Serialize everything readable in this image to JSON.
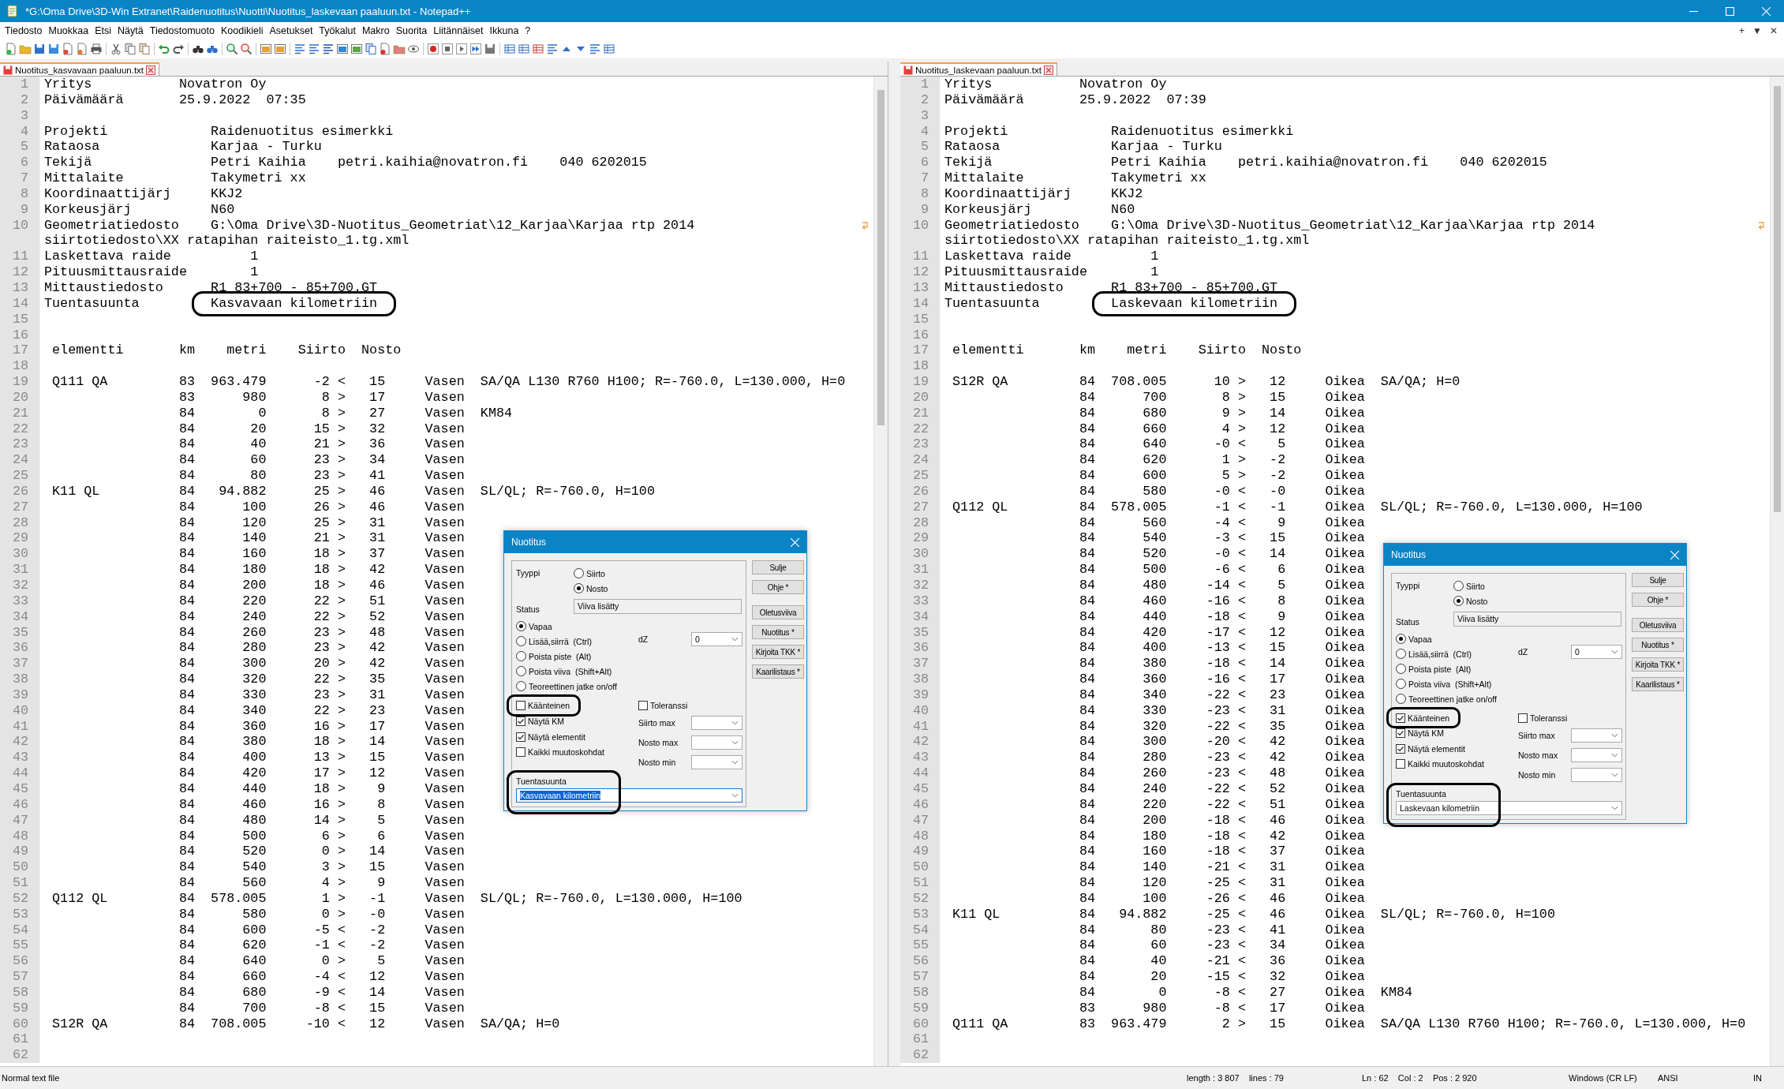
{
  "window": {
    "title": "*G:\\Oma Drive\\3D-Win Extranet\\Raidenuotitus\\Nuotti\\Nuotitus_laskevaan paaluun.txt - Notepad++"
  },
  "menu": [
    "Tiedosto",
    "Muokkaa",
    "Etsi",
    "Näytä",
    "Tiedostomuoto",
    "Koodikieli",
    "Asetukset",
    "Työkalut",
    "Makro",
    "Suorita",
    "Liitännäiset",
    "Ikkuna",
    "?"
  ],
  "menu_controls": [
    "+",
    "▼",
    "✕"
  ],
  "panes": [
    {
      "tab": {
        "label": "Nuotitus_kasvavaan paaluun.txt",
        "selected": true
      },
      "lines": [
        {
          "n": "1",
          "text": "Yritys           Novatron Oy",
          "outlined": false
        },
        {
          "n": "2",
          "text": "Päivämäärä       25.9.2022  07:35",
          "outlined": false
        },
        {
          "n": "3",
          "outlined": false
        },
        {
          "n": "4",
          "text": "Projekti             Raidenuotitus esimerkki",
          "outlined": false
        },
        {
          "n": "5",
          "text": "Rataosa              Karjaa - Turku",
          "outlined": false
        },
        {
          "n": "6",
          "text": "Tekijä               Petri Kaihia    petri.kaihia@novatron.fi    040 6202015",
          "outlined": false
        },
        {
          "n": "7",
          "text": "Mittalaite           Takymetri xx",
          "outlined": false
        },
        {
          "n": "8",
          "text": "Koordinaattijärj     KKJ2",
          "outlined": false
        },
        {
          "n": "9",
          "text": "Korkeusjärj          N60",
          "outlined": false
        },
        {
          "n": "10",
          "text": "Geometriatiedosto    G:\\Oma Drive\\3D-Nuotitus_Geometriat\\12_Karjaa\\Karjaa rtp 2014",
          "wrap": "siirtotiedosto\\XX ratapihan raiteisto_1.tg.xml",
          "outlined": false
        },
        {
          "n": "11",
          "text": "Laskettava raide          1",
          "outlined": false
        },
        {
          "n": "12",
          "text": "Pituusmittausraide        1",
          "outlined": false
        },
        {
          "n": "13",
          "text": "Mittaustiedosto      R1_83+700 - 85+700.GT",
          "outlined": false
        },
        {
          "n": "14",
          "text": "Tuentasuunta         Kasvavaan kilometriin",
          "outlined": true
        },
        {
          "n": "15",
          "outlined": false
        },
        {
          "n": "16",
          "outlined": false
        },
        {
          "n": "17",
          "text": " elementti       km    metri    Siirto  Nosto",
          "outlined": false
        },
        {
          "n": "18",
          "outlined": false
        },
        {
          "n": "19",
          "text": " Q111 QA         83  963.479      -2 <   15     Vasen  SA/QA L130 R760 H100; R=-760.0, L=130.000, H=0",
          "outlined": false
        },
        {
          "n": "20",
          "text": "                 83      980       8 >   17     Vasen",
          "outlined": false
        },
        {
          "n": "21",
          "text": "                 84        0       8 >   27     Vasen  KM84",
          "outlined": false
        },
        {
          "n": "22",
          "text": "                 84       20      15 >   32     Vasen",
          "outlined": false
        },
        {
          "n": "23",
          "text": "                 84       40      21 >   36     Vasen",
          "outlined": false
        },
        {
          "n": "24",
          "text": "                 84       60      23 >   34     Vasen",
          "outlined": false
        },
        {
          "n": "25",
          "text": "                 84       80      23 >   41     Vasen",
          "outlined": false
        },
        {
          "n": "26",
          "text": " K11 QL          84   94.882      25 >   46     Vasen  SL/QL; R=-760.0, H=100",
          "outlined": false
        },
        {
          "n": "27",
          "text": "                 84      100      26 >   46     Vasen",
          "outlined": false
        },
        {
          "n": "28",
          "text": "                 84      120      25 >   31     Vasen",
          "outlined": false
        },
        {
          "n": "29",
          "text": "                 84      140      21 >   31     Vasen",
          "outlined": false
        },
        {
          "n": "30",
          "text": "                 84      160      18 >   37     Vasen",
          "outlined": false
        },
        {
          "n": "31",
          "text": "                 84      180      18 >   42     Vasen",
          "outlined": false
        },
        {
          "n": "32",
          "text": "                 84      200      18 >   46     Vasen",
          "outlined": false
        },
        {
          "n": "33",
          "text": "                 84      220      22 >   51     Vasen",
          "outlined": false
        },
        {
          "n": "34",
          "text": "                 84      240      22 >   52     Vasen",
          "outlined": false
        },
        {
          "n": "35",
          "text": "                 84      260      23 >   48     Vasen",
          "outlined": false
        },
        {
          "n": "36",
          "text": "                 84      280      23 >   42     Vasen",
          "outlined": false
        },
        {
          "n": "37",
          "text": "                 84      300      20 >   42     Vasen",
          "outlined": false
        },
        {
          "n": "38",
          "text": "                 84      320      22 >   35     Vasen",
          "outlined": false
        },
        {
          "n": "39",
          "text": "                 84      330      23 >   31     Vasen",
          "outlined": false
        },
        {
          "n": "40",
          "text": "                 84      340      22 >   23     Vasen",
          "outlined": false
        },
        {
          "n": "41",
          "text": "                 84      360      16 >   17     Vasen",
          "outlined": false
        },
        {
          "n": "42",
          "text": "                 84      380      18 >   14     Vasen",
          "outlined": false
        },
        {
          "n": "43",
          "text": "                 84      400      13 >   15     Vasen",
          "outlined": false
        },
        {
          "n": "44",
          "text": "                 84      420      17 >   12     Vasen",
          "outlined": false
        },
        {
          "n": "45",
          "text": "                 84      440      18 >    9     Vasen",
          "outlined": false
        },
        {
          "n": "46",
          "text": "                 84      460      16 >    8     Vasen",
          "outlined": false
        },
        {
          "n": "47",
          "text": "                 84      480      14 >    5     Vasen",
          "outlined": false
        },
        {
          "n": "48",
          "text": "                 84      500       6 >    6     Vasen",
          "outlined": false
        },
        {
          "n": "49",
          "text": "                 84      520       0 >   14     Vasen",
          "outlined": false
        },
        {
          "n": "50",
          "text": "                 84      540       3 >   15     Vasen",
          "outlined": false
        },
        {
          "n": "51",
          "text": "                 84      560       4 >    9     Vasen",
          "outlined": false
        },
        {
          "n": "52",
          "text": " Q112 QL         84  578.005       1 >   -1     Vasen  SL/QL; R=-760.0, L=130.000, H=100",
          "outlined": false
        },
        {
          "n": "53",
          "text": "                 84      580       0 >   -0     Vasen",
          "outlined": false
        },
        {
          "n": "54",
          "text": "                 84      600      -5 <   -2     Vasen",
          "outlined": false
        },
        {
          "n": "55",
          "text": "                 84      620      -1 <   -2     Vasen",
          "outlined": false
        },
        {
          "n": "56",
          "text": "                 84      640       0 >    5     Vasen",
          "outlined": false
        },
        {
          "n": "57",
          "text": "                 84      660      -4 <   12     Vasen",
          "outlined": false
        },
        {
          "n": "58",
          "text": "                 84      680      -9 <   14     Vasen",
          "outlined": false
        },
        {
          "n": "59",
          "text": "                 84      700      -8 <   15     Vasen",
          "outlined": false
        },
        {
          "n": "60",
          "text": " S12R QA         84  708.005     -10 <   12     Vasen  SA/QA; H=0",
          "outlined": false
        },
        {
          "n": "61",
          "outlined": false
        },
        {
          "n": "62",
          "outlined": false
        }
      ],
      "dialog": {
        "title": "Nuotitus",
        "type_label": "Tyyppi",
        "type_options": [
          {
            "label": "Siirto",
            "selected": false
          },
          {
            "label": "Nosto",
            "selected": true
          }
        ],
        "status_label": "Status",
        "status_value": "Viiva lisätty",
        "modes": [
          {
            "label": "Vapaa",
            "selected": true
          },
          {
            "label": "Lisää,siirrä  (Ctrl)",
            "selected": false
          },
          {
            "label": "Poista piste  (Alt)",
            "selected": false
          },
          {
            "label": "Poista viiva  (Shift+Alt)",
            "selected": false
          },
          {
            "label": "Teoreettinen jatke on/off",
            "selected": false
          }
        ],
        "dz_label": "dZ",
        "dz_value": "0",
        "checkboxes": [
          {
            "label": "Käänteinen",
            "checked": false,
            "outlined": true
          },
          {
            "label": "Näytä KM",
            "checked": true,
            "outlined": false
          },
          {
            "label": "Näytä elementit",
            "checked": true,
            "outlined": false
          },
          {
            "label": "Kaikki muutoskohdat",
            "checked": false,
            "outlined": false
          }
        ],
        "tolerance": {
          "label": "Toleranssi",
          "checked": false
        },
        "limits": [
          {
            "label": "Siirto max"
          },
          {
            "label": "Nosto max"
          },
          {
            "label": "Nosto min"
          }
        ],
        "direction": {
          "label": "Tuentasuunta",
          "value": "Kasvavaan kilometriin",
          "text_selected": true,
          "outlined": true
        },
        "buttons": [
          "Sulje",
          "Ohje *",
          "Oletusviiva",
          "Nuotitus *",
          "Kirjoita TKK *",
          "Kaarilistaus *"
        ]
      }
    },
    {
      "tab": {
        "label": "Nuotitus_laskevaan paaluun.txt",
        "selected": true
      },
      "lines": [
        {
          "n": "1",
          "text": "Yritys           Novatron Oy",
          "outlined": false
        },
        {
          "n": "2",
          "text": "Päivämäärä       25.9.2022  07:39",
          "outlined": false
        },
        {
          "n": "3",
          "outlined": false
        },
        {
          "n": "4",
          "text": "Projekti             Raidenuotitus esimerkki",
          "outlined": false
        },
        {
          "n": "5",
          "text": "Rataosa              Karjaa - Turku",
          "outlined": false
        },
        {
          "n": "6",
          "text": "Tekijä               Petri Kaihia    petri.kaihia@novatron.fi    040 6202015",
          "outlined": false
        },
        {
          "n": "7",
          "text": "Mittalaite           Takymetri xx",
          "outlined": false
        },
        {
          "n": "8",
          "text": "Koordinaattijärj     KKJ2",
          "outlined": false
        },
        {
          "n": "9",
          "text": "Korkeusjärj          N60",
          "outlined": false
        },
        {
          "n": "10",
          "text": "Geometriatiedosto    G:\\Oma Drive\\3D-Nuotitus_Geometriat\\12_Karjaa\\Karjaa rtp 2014",
          "wrap": "siirtotiedosto\\XX ratapihan raiteisto_1.tg.xml",
          "outlined": false
        },
        {
          "n": "11",
          "text": "Laskettava raide          1",
          "outlined": false
        },
        {
          "n": "12",
          "text": "Pituusmittausraide        1",
          "outlined": false
        },
        {
          "n": "13",
          "text": "Mittaustiedosto      R1_83+700 - 85+700.GT",
          "outlined": false
        },
        {
          "n": "14",
          "text": "Tuentasuunta         Laskevaan kilometriin",
          "outlined": true
        },
        {
          "n": "15",
          "outlined": false
        },
        {
          "n": "16",
          "outlined": false
        },
        {
          "n": "17",
          "text": " elementti       km    metri    Siirto  Nosto",
          "outlined": false
        },
        {
          "n": "18",
          "outlined": false
        },
        {
          "n": "19",
          "text": " S12R QA         84  708.005      10 >   12     Oikea  SA/QA; H=0",
          "outlined": false
        },
        {
          "n": "20",
          "text": "                 84      700       8 >   15     Oikea",
          "outlined": false
        },
        {
          "n": "21",
          "text": "                 84      680       9 >   14     Oikea",
          "outlined": false
        },
        {
          "n": "22",
          "text": "                 84      660       4 >   12     Oikea",
          "outlined": false
        },
        {
          "n": "23",
          "text": "                 84      640      -0 <    5     Oikea",
          "outlined": false
        },
        {
          "n": "24",
          "text": "                 84      620       1 >   -2     Oikea",
          "outlined": false
        },
        {
          "n": "25",
          "text": "                 84      600       5 >   -2     Oikea",
          "outlined": false
        },
        {
          "n": "26",
          "text": "                 84      580      -0 <   -0     Oikea",
          "outlined": false
        },
        {
          "n": "27",
          "text": " Q112 QL         84  578.005      -1 <   -1     Oikea  SL/QL; R=-760.0, L=130.000, H=100",
          "outlined": false
        },
        {
          "n": "28",
          "text": "                 84      560      -4 <    9     Oikea",
          "outlined": false
        },
        {
          "n": "29",
          "text": "                 84      540      -3 <   15     Oikea",
          "outlined": false
        },
        {
          "n": "30",
          "text": "                 84      520      -0 <   14     Oikea",
          "outlined": false
        },
        {
          "n": "31",
          "text": "                 84      500      -6 <    6     Oikea",
          "outlined": false
        },
        {
          "n": "32",
          "text": "                 84      480     -14 <    5     Oikea",
          "outlined": false
        },
        {
          "n": "33",
          "text": "                 84      460     -16 <    8     Oikea",
          "outlined": false
        },
        {
          "n": "34",
          "text": "                 84      440     -18 <    9     Oikea",
          "outlined": false
        },
        {
          "n": "35",
          "text": "                 84      420     -17 <   12     Oikea",
          "outlined": false
        },
        {
          "n": "36",
          "text": "                 84      400     -13 <   15     Oikea",
          "outlined": false
        },
        {
          "n": "37",
          "text": "                 84      380     -18 <   14     Oikea",
          "outlined": false
        },
        {
          "n": "38",
          "text": "                 84      360     -16 <   17     Oikea",
          "outlined": false
        },
        {
          "n": "39",
          "text": "                 84      340     -22 <   23     Oikea",
          "outlined": false
        },
        {
          "n": "40",
          "text": "                 84      330     -23 <   31     Oikea",
          "outlined": false
        },
        {
          "n": "41",
          "text": "                 84      320     -22 <   35     Oikea",
          "outlined": false
        },
        {
          "n": "42",
          "text": "                 84      300     -20 <   42     Oikea",
          "outlined": false
        },
        {
          "n": "43",
          "text": "                 84      280     -23 <   42     Oikea",
          "outlined": false
        },
        {
          "n": "44",
          "text": "                 84      260     -23 <   48     Oikea",
          "outlined": false
        },
        {
          "n": "45",
          "text": "                 84      240     -22 <   52     Oikea",
          "outlined": false
        },
        {
          "n": "46",
          "text": "                 84      220     -22 <   51     Oikea",
          "outlined": false
        },
        {
          "n": "47",
          "text": "                 84      200     -18 <   46     Oikea",
          "outlined": false
        },
        {
          "n": "48",
          "text": "                 84      180     -18 <   42     Oikea",
          "outlined": false
        },
        {
          "n": "49",
          "text": "                 84      160     -18 <   37     Oikea",
          "outlined": false
        },
        {
          "n": "50",
          "text": "                 84      140     -21 <   31     Oikea",
          "outlined": false
        },
        {
          "n": "51",
          "text": "                 84      120     -25 <   31     Oikea",
          "outlined": false
        },
        {
          "n": "52",
          "text": "                 84      100     -26 <   46     Oikea",
          "outlined": false
        },
        {
          "n": "53",
          "text": " K11 QL          84   94.882     -25 <   46     Oikea  SL/QL; R=-760.0, H=100",
          "outlined": false
        },
        {
          "n": "54",
          "text": "                 84       80     -23 <   41     Oikea",
          "outlined": false
        },
        {
          "n": "55",
          "text": "                 84       60     -23 <   34     Oikea",
          "outlined": false
        },
        {
          "n": "56",
          "text": "                 84       40     -21 <   36     Oikea",
          "outlined": false
        },
        {
          "n": "57",
          "text": "                 84       20     -15 <   32     Oikea",
          "outlined": false
        },
        {
          "n": "58",
          "text": "                 84        0      -8 <   27     Oikea  KM84",
          "outlined": false
        },
        {
          "n": "59",
          "text": "                 83      980      -8 <   17     Oikea",
          "outlined": false
        },
        {
          "n": "60",
          "text": " Q111 QA         83  963.479       2 >   15     Oikea  SA/QA L130 R760 H100; R=-760.0, L=130.000, H=0",
          "outlined": false
        },
        {
          "n": "61",
          "outlined": false
        },
        {
          "n": "62",
          "outlined": false
        }
      ],
      "dialog": {
        "title": "Nuotitus",
        "type_label": "Tyyppi",
        "type_options": [
          {
            "label": "Siirto",
            "selected": false
          },
          {
            "label": "Nosto",
            "selected": true
          }
        ],
        "status_label": "Status",
        "status_value": "Viiva lisätty",
        "modes": [
          {
            "label": "Vapaa",
            "selected": true
          },
          {
            "label": "Lisää,siirrä  (Ctrl)",
            "selected": false
          },
          {
            "label": "Poista piste  (Alt)",
            "selected": false
          },
          {
            "label": "Poista viiva  (Shift+Alt)",
            "selected": false
          },
          {
            "label": "Teoreettinen jatke on/off",
            "selected": false
          }
        ],
        "dz_label": "dZ",
        "dz_value": "0",
        "checkboxes": [
          {
            "label": "Käänteinen",
            "checked": true,
            "outlined": true
          },
          {
            "label": "Näytä KM",
            "checked": true,
            "outlined": false
          },
          {
            "label": "Näytä elementit",
            "checked": true,
            "outlined": false
          },
          {
            "label": "Kaikki muutoskohdat",
            "checked": false,
            "outlined": false
          }
        ],
        "tolerance": {
          "label": "Toleranssi",
          "checked": false
        },
        "limits": [
          {
            "label": "Siirto max"
          },
          {
            "label": "Nosto max"
          },
          {
            "label": "Nosto min"
          }
        ],
        "direction": {
          "label": "Tuentasuunta",
          "value": "Laskevaan kilometriin",
          "text_selected": false,
          "outlined": true
        },
        "buttons": [
          "Sulje",
          "Ohje *",
          "Oletusviiva",
          "Nuotitus *",
          "Kirjoita TKK *",
          "Kaarilistaus *"
        ]
      }
    }
  ],
  "status_bar": [
    "Normal text file",
    "length : 3 807    lines : 79",
    "Ln : 62    Col : 2    Pos : 2 920",
    "Windows (CR LF)",
    "ANSI",
    "IN"
  ]
}
